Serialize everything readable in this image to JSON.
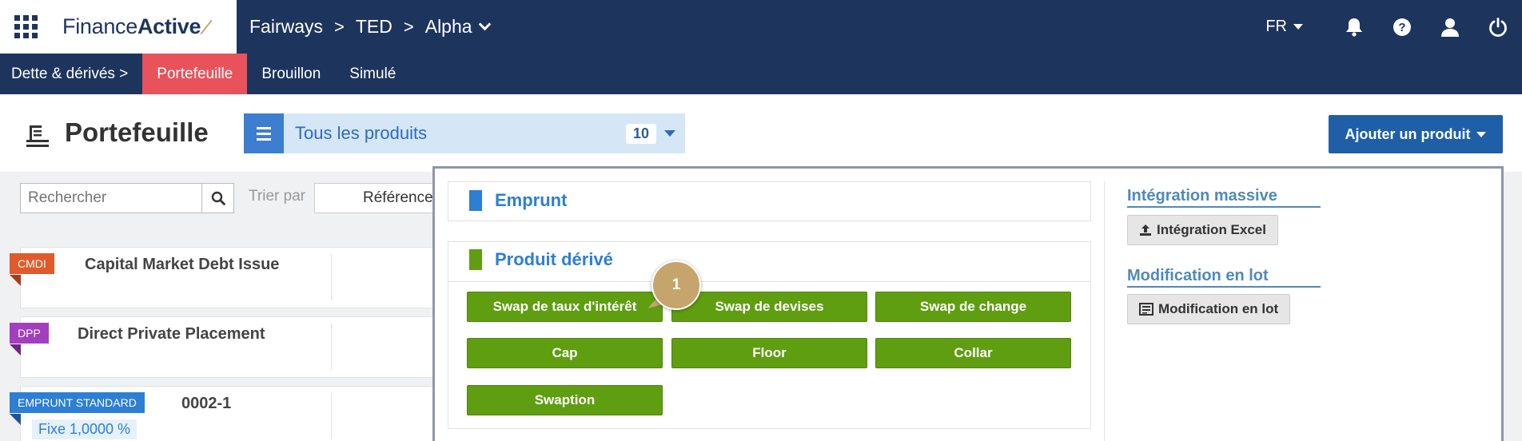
{
  "topbar": {
    "logo_regular": "Finance",
    "logo_bold": "Active",
    "breadcrumbs": [
      "Fairways",
      "TED",
      "Alpha"
    ],
    "language": "FR",
    "icons": [
      "apps-grid-icon",
      "bell-icon",
      "help-icon",
      "user-icon",
      "power-icon"
    ]
  },
  "subnav": {
    "items": [
      "Dette & dérivés >",
      "Portefeuille",
      "Brouillon",
      "Simulé"
    ],
    "active": "Portefeuille"
  },
  "header": {
    "title": "Portefeuille",
    "filter_label": "Tous les produits",
    "filter_count": "10",
    "add_button": "Ajouter un produit"
  },
  "toolbar": {
    "search_placeholder": "Rechercher",
    "sort_label": "Trier par",
    "sort_value": "Référence"
  },
  "list": [
    {
      "tag": "CMDI",
      "tag_color": "#e05a2b",
      "title": "Capital Market Debt Issue"
    },
    {
      "tag": "DPP",
      "tag_color": "#a23fbf",
      "title": "Direct Private Placement"
    },
    {
      "tag": "EMPRUNT STANDARD",
      "tag_color": "#2d7fd3",
      "title": "0002-1",
      "sub": "Fixe 1,0000 %"
    }
  ],
  "dropdown": {
    "emprunt": {
      "label": "Emprunt",
      "color": "#2d7fd3"
    },
    "derive": {
      "label": "Produit dérivé",
      "color": "#5f9e10",
      "buttons": [
        "Swap de taux d'intérêt",
        "Swap de devises",
        "Swap de change",
        "Cap",
        "Floor",
        "Collar",
        "Swaption"
      ]
    },
    "side": {
      "massive_head": "Intégration massive",
      "massive_btn": "Intégration Excel",
      "lot_head": "Modification en lot",
      "lot_btn": "Modification en lot"
    }
  },
  "step_bubble": "1"
}
